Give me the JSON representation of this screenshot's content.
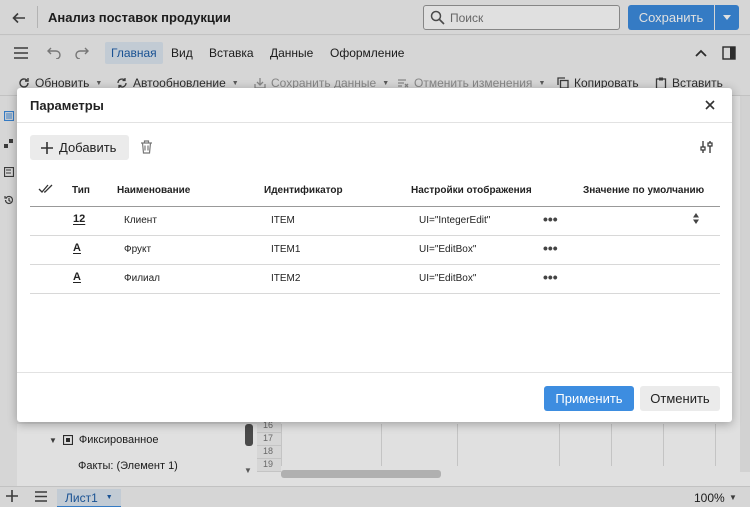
{
  "app": {
    "title": "Анализ поставок продукции",
    "search_placeholder": "Поиск",
    "save_label": "Сохранить"
  },
  "menu": {
    "items": [
      "Главная",
      "Вид",
      "Вставка",
      "Данные",
      "Оформление"
    ],
    "active": "Главная"
  },
  "toolbar": {
    "refresh": "Обновить",
    "autorefresh": "Автообновление",
    "save_data": "Сохранить данные",
    "cancel_changes": "Отменить изменения",
    "copy": "Копировать",
    "paste": "Вставить"
  },
  "tree": {
    "fixed": "Фиксированное",
    "facts": "Факты: (Элемент 1)"
  },
  "sheet": {
    "row_numbers": [
      "16",
      "17",
      "18",
      "19"
    ]
  },
  "bottombar": {
    "sheet_tab": "Лист1",
    "zoom": "100%"
  },
  "dialog": {
    "title": "Параметры",
    "add_label": "Добавить",
    "columns": {
      "type": "Тип",
      "name": "Наименование",
      "identifier": "Идентификатор",
      "display": "Настройки отображения",
      "default": "Значение по умолчанию"
    },
    "rows": [
      {
        "type_icon": "12",
        "name": "Клиент",
        "identifier": "ITEM",
        "display": "UI=\"IntegerEdit\""
      },
      {
        "type_icon": "A",
        "name": "Фрукт",
        "identifier": "ITEM1",
        "display": "UI=\"EditBox\""
      },
      {
        "type_icon": "A",
        "name": "Филиал",
        "identifier": "ITEM2",
        "display": "UI=\"EditBox\""
      }
    ],
    "apply_label": "Применить",
    "cancel_label": "Отменить",
    "more": "•••"
  },
  "colors": {
    "accent": "#3d8de0",
    "active_tab_bg": "#dde7f2"
  }
}
